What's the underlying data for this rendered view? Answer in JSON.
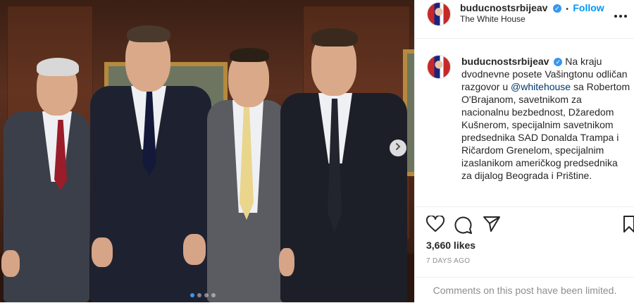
{
  "post": {
    "username": "buducnostsrbijeav",
    "follow_label": "Follow",
    "separator": "•",
    "location": "The White House",
    "caption_before_mention": "Na kraju dvodnevne posete Vašingtonu odličan razgovor u ",
    "caption_mention": "@whitehouse",
    "caption_after_mention": " sa Robertom O'Brajanom, savetnikom za nacionalnu bezbednost, Džaredom Kušnerom, specijalnim savetnikom predsednika SAD Donalda Trampa i Ričardom Grenelom, specijalnim izaslanikom američkog predsednika za dijalog Beograda i Prištine.",
    "likes": "3,660 likes",
    "time": "7 DAYS AGO",
    "comments_limited": "Comments on this post have been limited."
  },
  "carousel": {
    "total_slides": 4,
    "current_slide": 1
  },
  "icons": {
    "like": "heart-icon",
    "comment": "comment-icon",
    "share": "paper-plane-icon",
    "save": "bookmark-icon",
    "next": "chevron-right-icon",
    "more": "more-options-icon",
    "verified": "verified-badge-icon"
  },
  "colors": {
    "link": "#0095f6",
    "mention": "#00376b",
    "muted": "#8e8e8e",
    "verified": "#3897f0"
  }
}
